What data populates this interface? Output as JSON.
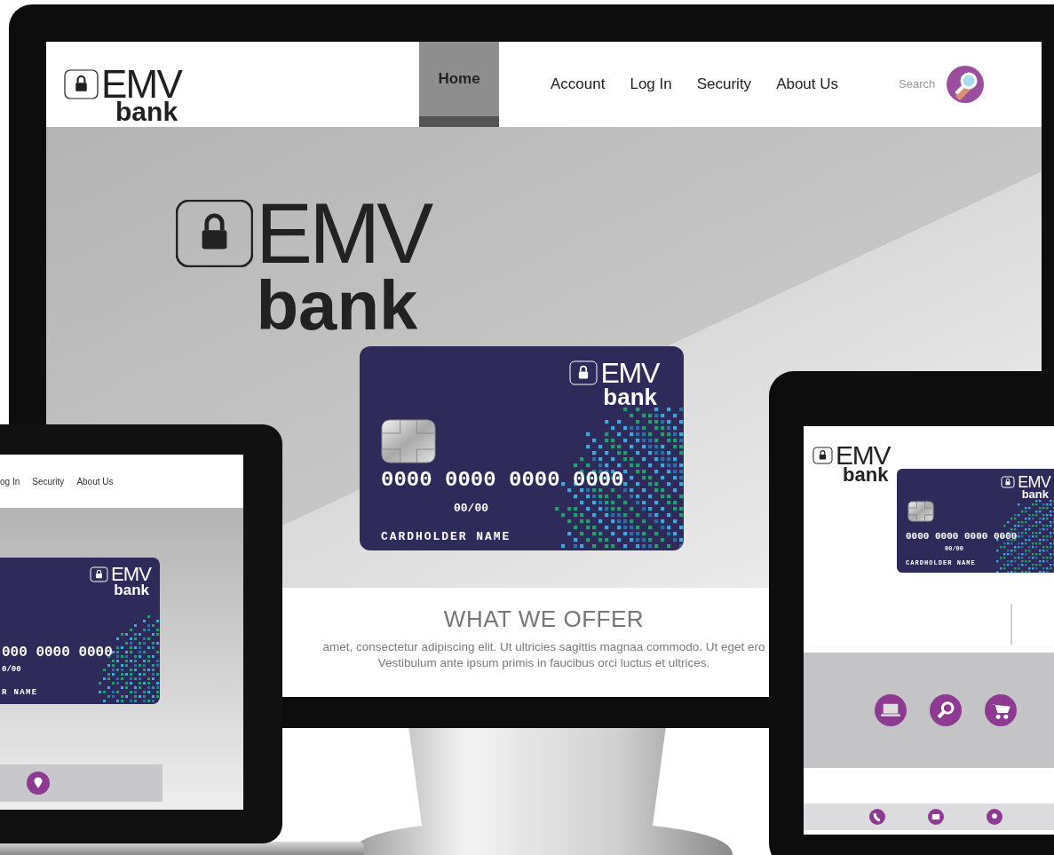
{
  "monitor": {
    "logo": {
      "brand": "EMV",
      "sub": "bank"
    },
    "nav": [
      {
        "label": "Home",
        "selected": true
      },
      {
        "label": "Account",
        "selected": false
      },
      {
        "label": "Log In",
        "selected": false
      },
      {
        "label": "Security",
        "selected": false
      },
      {
        "label": "About Us",
        "selected": false
      }
    ],
    "search": {
      "placeholder": "Search"
    },
    "hero_logo": {
      "brand": "EMV",
      "sub": "bank"
    },
    "card": {
      "brand": "EMV",
      "sub": "bank",
      "number": "0000 0000 0000 0000",
      "expiry": "00/00",
      "holder": "CARDHOLDER NAME"
    },
    "offer": {
      "title": "WHAT WE OFFER",
      "lines": [
        "amet, consectetur adipiscing elit. Ut ultricies sagittis magnaa commodo. Ut eget ero",
        "Vestibulum ante ipsum primis in faucibus orci luctus et ultrices."
      ]
    }
  },
  "laptop": {
    "nav": [
      {
        "label": "og In",
        "selected": false
      },
      {
        "label": "Security",
        "selected": false
      },
      {
        "label": "About Us",
        "selected": false
      }
    ],
    "card": {
      "brand": "EMV",
      "sub": "bank",
      "number": "000 0000 0000",
      "expiry": "0/00",
      "holder": "R NAME"
    }
  },
  "tablet": {
    "logo": {
      "brand": "EMV",
      "sub": "bank"
    },
    "card": {
      "brand": "EMV",
      "sub": "bank",
      "number": "0000 0000 0000 0000",
      "expiry": "00/00",
      "holder": "CARDHOLDER NAME"
    }
  }
}
